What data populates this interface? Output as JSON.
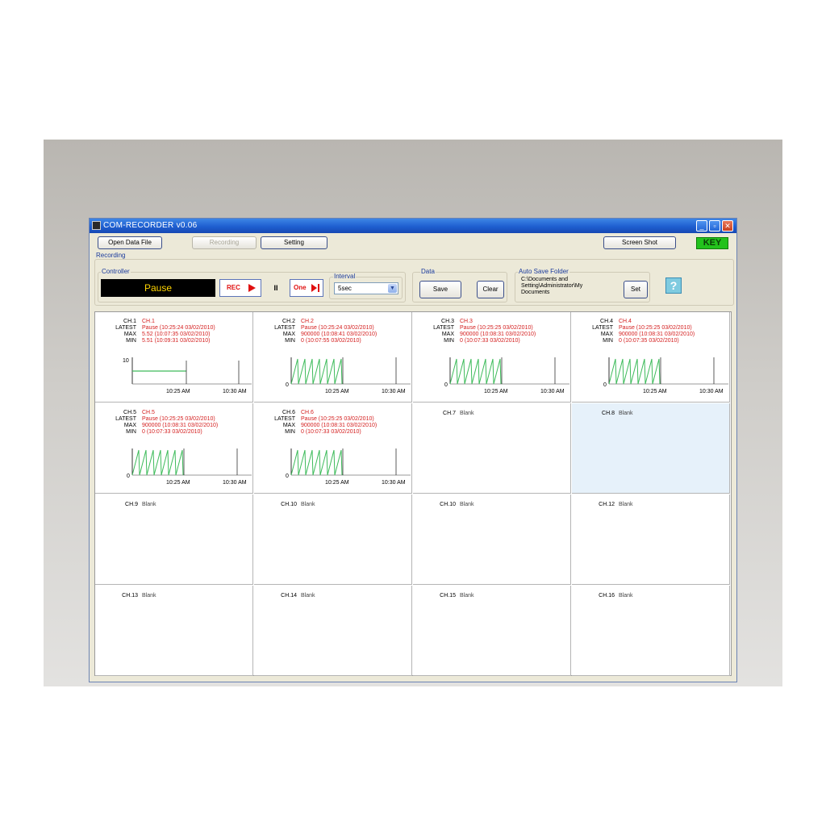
{
  "window": {
    "title": "COM-RECORDER v0.06",
    "controls": {
      "minimize": "_",
      "maximize": "▫",
      "close": "✕"
    }
  },
  "toolbar": {
    "open_data_file": "Open Data File",
    "recording": "Recording",
    "setting": "Setting",
    "screen_shot": "Screen Shot",
    "key": "KEY"
  },
  "recording_label": "Recording",
  "controller": {
    "title": "Controller",
    "display": "Pause",
    "rec": "REC",
    "pause": "II",
    "one": "One"
  },
  "interval": {
    "title": "Interval",
    "value": "5sec"
  },
  "data_group": {
    "title": "Data",
    "save": "Save",
    "clear": "Clear"
  },
  "auto_save": {
    "title": "Auto Save Folder",
    "path_lines": [
      "C:\\Documents and",
      "Setting\\Administrator\\My",
      "Documents"
    ],
    "set": "Set"
  },
  "help_icon": "?",
  "row_labels": {
    "ch": "CH.",
    "latest": "LATEST",
    "max": "MAX",
    "min": "MIN"
  },
  "channels": [
    {
      "label": "CH.1",
      "name": "CH.1",
      "latest": "Pause  (10:25:24 03/02/2010)",
      "max": "5.52  (10:07:35 03/02/2010)",
      "min": "5.51  (10:09:31 03/02/2010)",
      "chart": {
        "type": "flat",
        "y_top": "10",
        "y_bottom": "",
        "x_labels": [
          "10:25 AM",
          "10:30 AM"
        ]
      }
    },
    {
      "label": "CH.2",
      "name": "CH.2",
      "latest": "Pause  (10:25:24 03/02/2010)",
      "max": "900000  (10:08:41 03/02/2010)",
      "min": "0  (10:07:55 03/02/2010)",
      "chart": {
        "type": "saw",
        "y_top": "",
        "y_bottom": "0",
        "x_labels": [
          "10:25 AM",
          "10:30 AM"
        ]
      }
    },
    {
      "label": "CH.3",
      "name": "CH.3",
      "latest": "Pause  (10:25:25 03/02/2010)",
      "max": "900000  (10:08:31 03/02/2010)",
      "min": "0  (10:07:33 03/02/2010)",
      "chart": {
        "type": "saw",
        "y_top": "",
        "y_bottom": "0",
        "x_labels": [
          "10:25 AM",
          "10:30 AM"
        ]
      }
    },
    {
      "label": "CH.4",
      "name": "CH.4",
      "latest": "Pause  (10:25:25 03/02/2010)",
      "max": "900000  (10:08:31 03/02/2010)",
      "min": "0  (10:07:35 03/02/2010)",
      "chart": {
        "type": "saw",
        "y_top": "",
        "y_bottom": "0",
        "x_labels": [
          "10:25 AM",
          "10:30 AM"
        ]
      }
    },
    {
      "label": "CH.5",
      "name": "CH.5",
      "latest": "Pause  (10:25:25 03/02/2010)",
      "max": "900000  (10:08:31 03/02/2010)",
      "min": "0  (10:07:33 03/02/2010)",
      "chart": {
        "type": "saw",
        "y_top": "",
        "y_bottom": "0",
        "x_labels": [
          "10:25 AM",
          "10:30 AM"
        ]
      }
    },
    {
      "label": "CH.6",
      "name": "CH.6",
      "latest": "Pause  (10:25:25 03/02/2010)",
      "max": "900000  (10:08:31 03/02/2010)",
      "min": "0  (10:07:33 03/02/2010)",
      "chart": {
        "type": "saw",
        "y_top": "",
        "y_bottom": "0",
        "x_labels": [
          "10:25 AM",
          "10:30 AM"
        ]
      }
    },
    {
      "label": "CH.7",
      "blank": "Blank"
    },
    {
      "label": "CH.8",
      "blank": "Blank",
      "selected": true
    },
    {
      "label": "CH.9",
      "blank": "Blank"
    },
    {
      "label": "CH.10",
      "blank": "Blank"
    },
    {
      "label": "CH.10",
      "blank": "Blank"
    },
    {
      "label": "CH.12",
      "blank": "Blank"
    },
    {
      "label": "CH.13",
      "blank": "Blank"
    },
    {
      "label": "CH.14",
      "blank": "Blank"
    },
    {
      "label": "CH.15",
      "blank": "Blank"
    },
    {
      "label": "CH.16",
      "blank": "Blank"
    }
  ],
  "colors": {
    "trace": "#3dbb5a",
    "values": "#d41e1e",
    "titlebar": "#1f5fd0",
    "key_badge": "#23c21c",
    "pause_text": "#ffd400"
  }
}
